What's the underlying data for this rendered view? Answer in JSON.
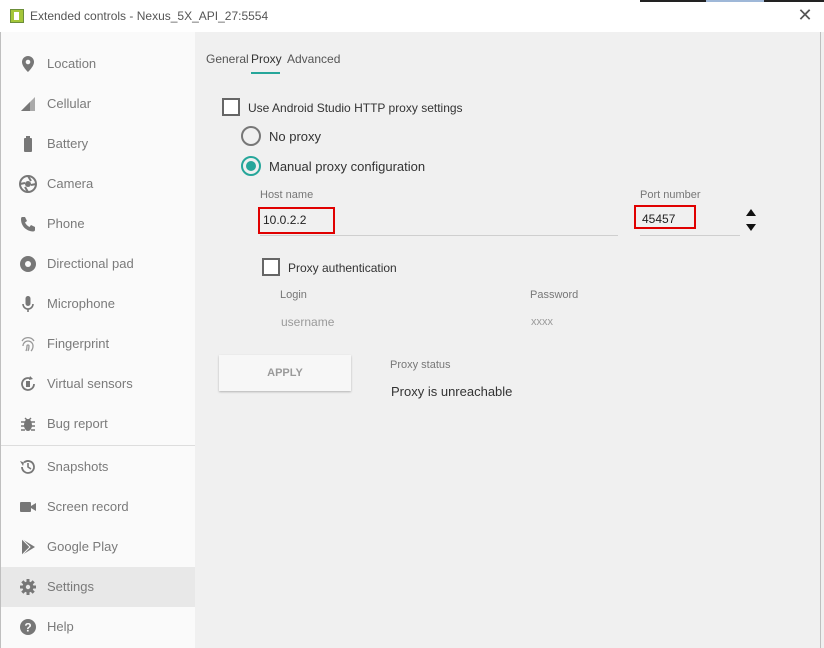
{
  "window": {
    "title": "Extended controls - Nexus_5X_API_27:5554",
    "close_glyph": "✕"
  },
  "sidebar": {
    "items": [
      {
        "label": "Location",
        "icon": "location-pin-icon"
      },
      {
        "label": "Cellular",
        "icon": "signal-icon"
      },
      {
        "label": "Battery",
        "icon": "battery-icon"
      },
      {
        "label": "Camera",
        "icon": "camera-icon"
      },
      {
        "label": "Phone",
        "icon": "phone-icon"
      },
      {
        "label": "Directional pad",
        "icon": "dpad-icon"
      },
      {
        "label": "Microphone",
        "icon": "microphone-icon"
      },
      {
        "label": "Fingerprint",
        "icon": "fingerprint-icon"
      },
      {
        "label": "Virtual sensors",
        "icon": "rotate-icon"
      },
      {
        "label": "Bug report",
        "icon": "bug-icon"
      },
      {
        "label": "Snapshots",
        "icon": "history-icon"
      },
      {
        "label": "Screen record",
        "icon": "video-camera-icon"
      },
      {
        "label": "Google Play",
        "icon": "play-store-icon"
      },
      {
        "label": "Settings",
        "icon": "gear-icon"
      },
      {
        "label": "Help",
        "icon": "help-icon"
      }
    ],
    "active": "Settings"
  },
  "tabs": {
    "general": "General",
    "proxy": "Proxy",
    "advanced": "Advanced",
    "active": "Proxy"
  },
  "proxy": {
    "use_studio_label": "Use Android Studio HTTP proxy settings",
    "use_studio_checked": false,
    "no_proxy_label": "No proxy",
    "manual_label": "Manual proxy configuration",
    "selected": "manual",
    "host_label": "Host name",
    "host_value": "10.0.2.2",
    "port_label": "Port number",
    "port_value": "45457",
    "auth_label": "Proxy authentication",
    "auth_checked": false,
    "login_label": "Login",
    "login_placeholder": "username",
    "password_label": "Password",
    "password_placeholder": "xxxx",
    "apply_label": "APPLY",
    "status_label": "Proxy status",
    "status_value": "Proxy is unreachable"
  },
  "colors": {
    "accent": "#26a69a",
    "highlight": "#e00000"
  }
}
